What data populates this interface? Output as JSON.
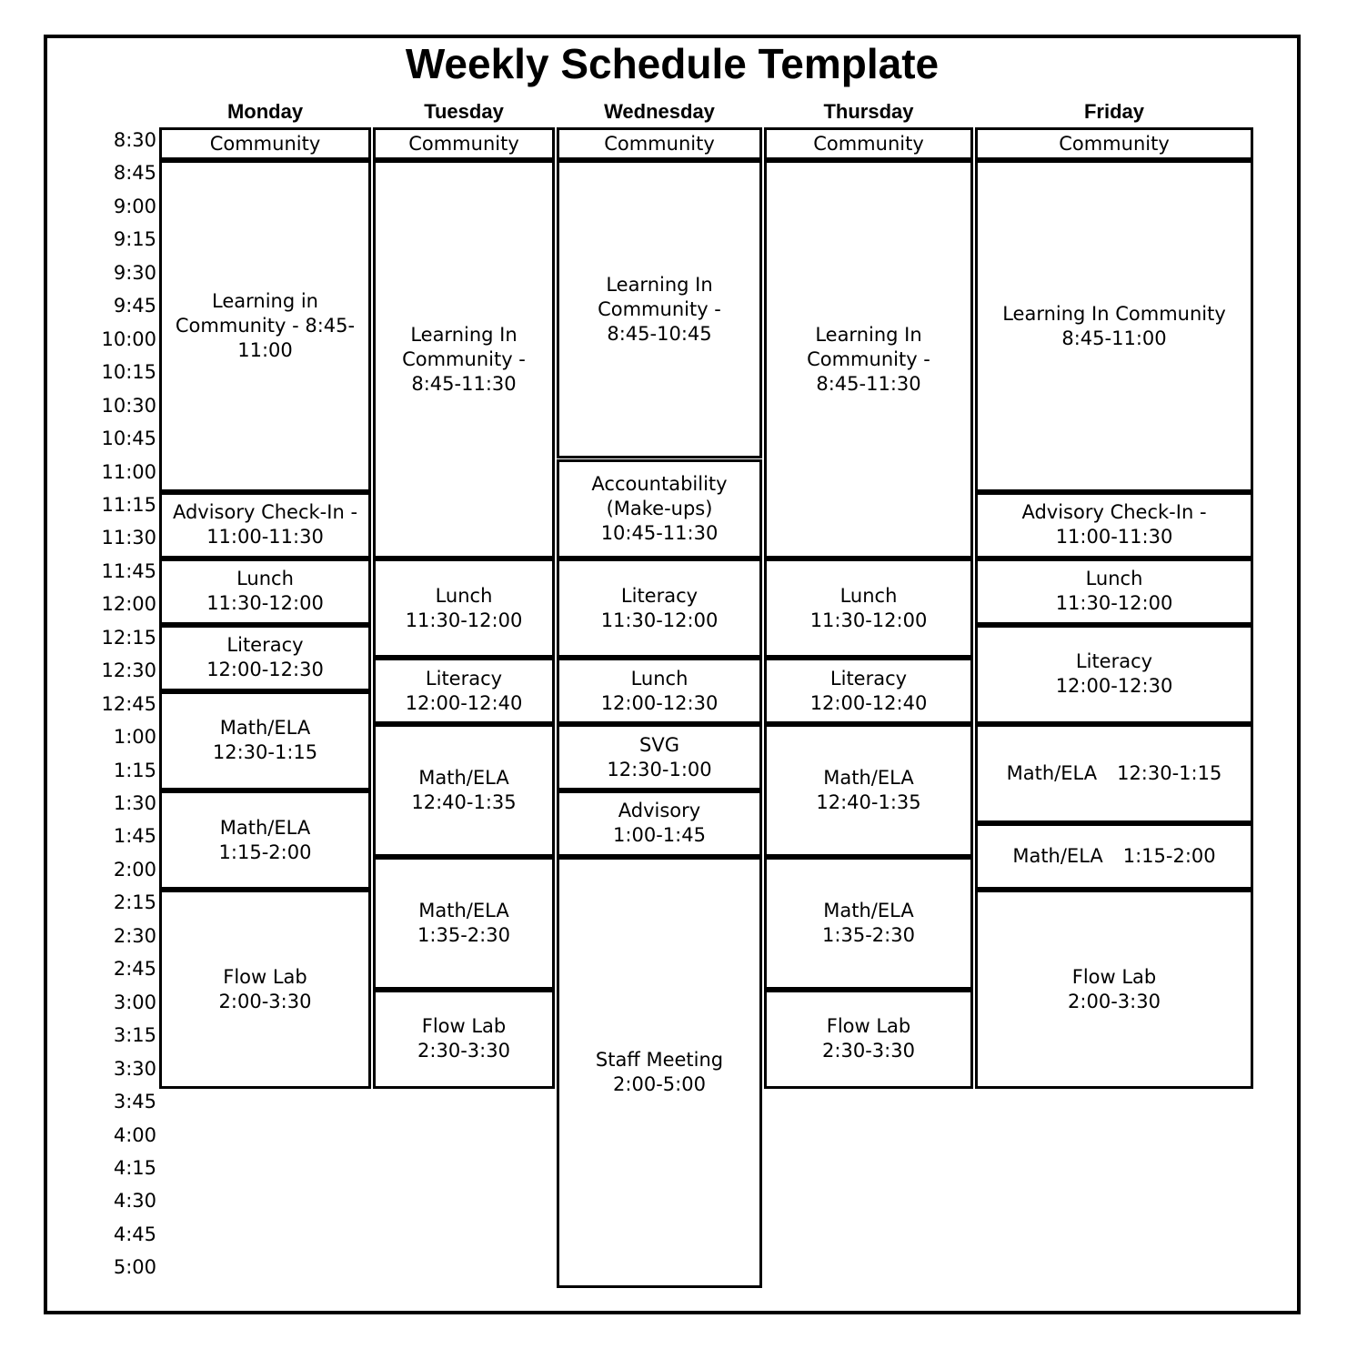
{
  "title": "Weekly Schedule Template",
  "days": [
    "Monday",
    "Tuesday",
    "Wednesday",
    "Thursday",
    "Friday"
  ],
  "times": [
    "8:30",
    "8:45",
    "9:00",
    "9:15",
    "9:30",
    "9:45",
    "10:00",
    "10:15",
    "10:30",
    "10:45",
    "11:00",
    "11:15",
    "11:30",
    "11:45",
    "12:00",
    "12:15",
    "12:30",
    "12:45",
    "1:00",
    "1:15",
    "1:30",
    "1:45",
    "2:00",
    "2:15",
    "2:30",
    "2:45",
    "3:00",
    "3:15",
    "3:30",
    "3:45",
    "4:00",
    "4:15",
    "4:30",
    "4:45",
    "5:00"
  ],
  "schedule": {
    "monday": [
      {
        "name": "community",
        "lines": [
          "Community"
        ],
        "start": 0,
        "end": 1
      },
      {
        "name": "learning-in-community",
        "lines": [
          "Learning in",
          "Community -     8:45-",
          "11:00"
        ],
        "start": 1,
        "end": 11
      },
      {
        "name": "advisory-check-in",
        "lines": [
          "Advisory Check-In -",
          "11:00-11:30"
        ],
        "start": 11,
        "end": 13
      },
      {
        "name": "lunch",
        "lines": [
          "Lunch",
          "11:30-12:00"
        ],
        "start": 13,
        "end": 15
      },
      {
        "name": "literacy",
        "lines": [
          "Literacy",
          "12:00-12:30"
        ],
        "start": 15,
        "end": 17
      },
      {
        "name": "math-ela-1",
        "lines": [
          "Math/ELA",
          "12:30-1:15"
        ],
        "start": 17,
        "end": 20
      },
      {
        "name": "math-ela-2",
        "lines": [
          "Math/ELA",
          "1:15-2:00"
        ],
        "start": 20,
        "end": 23
      },
      {
        "name": "flow-lab",
        "lines": [
          "Flow Lab",
          "2:00-3:30"
        ],
        "start": 23,
        "end": 29
      }
    ],
    "tuesday": [
      {
        "name": "community",
        "lines": [
          "Community"
        ],
        "start": 0,
        "end": 1
      },
      {
        "name": "learning-in-community",
        "lines": [
          "Learning In",
          "Community -",
          "8:45-11:30"
        ],
        "start": 1,
        "end": 13
      },
      {
        "name": "lunch",
        "lines": [
          "Lunch",
          "11:30-12:00"
        ],
        "start": 13,
        "end": 16
      },
      {
        "name": "literacy",
        "lines": [
          "Literacy",
          "12:00-12:40"
        ],
        "start": 16,
        "end": 18
      },
      {
        "name": "math-ela-1",
        "lines": [
          "Math/ELA",
          "12:40-1:35"
        ],
        "start": 18,
        "end": 22
      },
      {
        "name": "math-ela-2",
        "lines": [
          "Math/ELA",
          "1:35-2:30"
        ],
        "start": 22,
        "end": 26
      },
      {
        "name": "flow-lab",
        "lines": [
          "Flow Lab",
          "2:30-3:30"
        ],
        "start": 26,
        "end": 29
      }
    ],
    "wednesday": [
      {
        "name": "community",
        "lines": [
          "Community"
        ],
        "start": 0,
        "end": 1
      },
      {
        "name": "learning-in-community",
        "lines": [
          "Learning In",
          "Community -",
          "8:45-10:45"
        ],
        "start": 1,
        "end": 10
      },
      {
        "name": "accountability",
        "lines": [
          "Accountability",
          "(Make-ups)",
          "10:45-11:30"
        ],
        "start": 10,
        "end": 13
      },
      {
        "name": "literacy",
        "lines": [
          "Literacy",
          "11:30-12:00"
        ],
        "start": 13,
        "end": 16
      },
      {
        "name": "lunch",
        "lines": [
          "Lunch",
          "12:00-12:30"
        ],
        "start": 16,
        "end": 18
      },
      {
        "name": "svg",
        "lines": [
          "SVG",
          "12:30-1:00"
        ],
        "start": 18,
        "end": 20
      },
      {
        "name": "advisory",
        "lines": [
          "Advisory",
          "1:00-1:45"
        ],
        "start": 20,
        "end": 22
      },
      {
        "name": "staff-meeting",
        "lines": [
          "Staff Meeting",
          "2:00-5:00"
        ],
        "start": 22,
        "end": 35
      }
    ],
    "thursday": [
      {
        "name": "community",
        "lines": [
          "Community"
        ],
        "start": 0,
        "end": 1
      },
      {
        "name": "learning-in-community",
        "lines": [
          "Learning In",
          "Community -",
          "8:45-11:30"
        ],
        "start": 1,
        "end": 13
      },
      {
        "name": "lunch",
        "lines": [
          "Lunch",
          "11:30-12:00"
        ],
        "start": 13,
        "end": 16
      },
      {
        "name": "literacy",
        "lines": [
          "Literacy",
          "12:00-12:40"
        ],
        "start": 16,
        "end": 18
      },
      {
        "name": "math-ela-1",
        "lines": [
          "Math/ELA",
          "12:40-1:35"
        ],
        "start": 18,
        "end": 22
      },
      {
        "name": "math-ela-2",
        "lines": [
          "Math/ELA",
          "1:35-2:30"
        ],
        "start": 22,
        "end": 26
      },
      {
        "name": "flow-lab",
        "lines": [
          "Flow Lab",
          "2:30-3:30"
        ],
        "start": 26,
        "end": 29
      }
    ],
    "friday": [
      {
        "name": "community",
        "lines": [
          "Community"
        ],
        "start": 0,
        "end": 1
      },
      {
        "name": "learning-in-community",
        "lines": [
          "Learning In Community",
          "8:45-11:00"
        ],
        "start": 1,
        "end": 11
      },
      {
        "name": "advisory-check-in",
        "lines": [
          "Advisory Check-In -",
          "11:00-11:30"
        ],
        "start": 11,
        "end": 13
      },
      {
        "name": "lunch",
        "lines": [
          "Lunch",
          "11:30-12:00"
        ],
        "start": 13,
        "end": 15
      },
      {
        "name": "literacy",
        "lines": [
          "Literacy",
          "12:00-12:30"
        ],
        "start": 15,
        "end": 18
      },
      {
        "name": "math-ela-1",
        "lines": [
          "Math/ELA",
          "12:30-1:15"
        ],
        "start": 18,
        "end": 21,
        "inline": true
      },
      {
        "name": "math-ela-2",
        "lines": [
          "Math/ELA",
          "1:15-2:00"
        ],
        "start": 21,
        "end": 23,
        "inline": true
      },
      {
        "name": "flow-lab",
        "lines": [
          "Flow Lab",
          "2:00-3:30"
        ],
        "start": 23,
        "end": 29
      }
    ]
  }
}
